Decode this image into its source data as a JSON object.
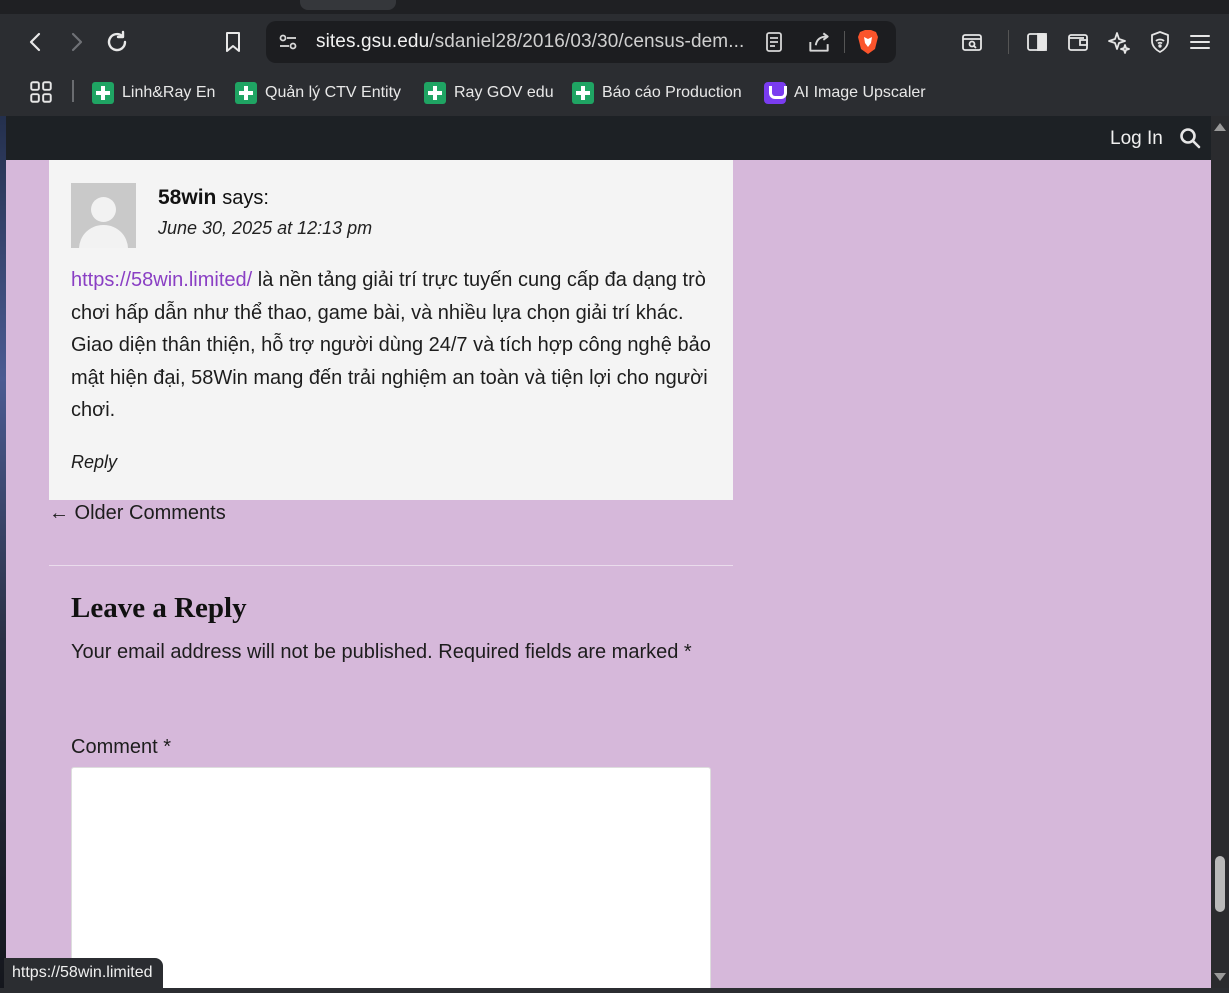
{
  "browser": {
    "url_host": "sites.gsu.edu",
    "url_path": "/sdaniel28/2016/03/30/census-dem...",
    "status_url": "https://58win.limited"
  },
  "bookmarks": [
    {
      "label": "Linh&Ray En",
      "icon": "sheets-icon"
    },
    {
      "label": "Quản lý CTV Entity",
      "icon": "sheets-icon"
    },
    {
      "label": "Ray GOV edu",
      "icon": "sheets-icon"
    },
    {
      "label": "Báo cáo Production",
      "icon": "sheets-icon"
    },
    {
      "label": "AI Image Upscaler",
      "icon": "upscaler-icon"
    }
  ],
  "site_header": {
    "login_label": "Log In"
  },
  "comment": {
    "author": "58win",
    "says": "says:",
    "date": "June 30, 2025 at 12:13 pm",
    "link_text": "https://58win.limited/",
    "body": " là nền tảng giải trí trực tuyến cung cấp đa dạng trò chơi hấp dẫn như thể thao, game bài, và nhiều lựa chọn giải trí khác. Giao diện thân thiện, hỗ trợ người dùng 24/7 và tích hợp công nghệ bảo mật hiện đại, 58Win mang đến trải nghiệm an toàn và tiện lợi cho người chơi.",
    "reply_label": "Reply"
  },
  "older_comments": "← Older Comments",
  "reply_form": {
    "title": "Leave a Reply",
    "note": "Your email address will not be published. Required fields are marked *",
    "comment_label": "Comment *",
    "comment_value": ""
  },
  "colors": {
    "page_bg": "#d6b8da",
    "link": "#8a3fc4",
    "header_bg": "#1d2125"
  }
}
